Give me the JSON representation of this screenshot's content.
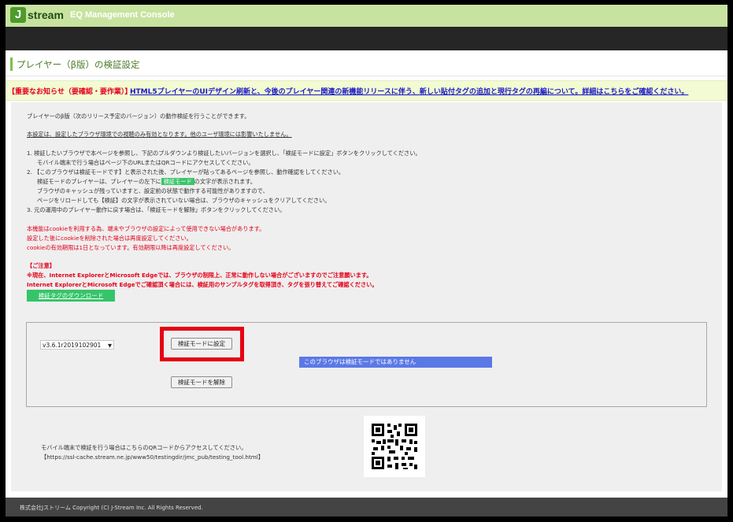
{
  "header": {
    "logo_mark": "J",
    "logo_text": "stream",
    "app_title": "EQ Management Console"
  },
  "page_title": "プレイヤー（β版）の検証設定",
  "notice": {
    "tag": "【重要なお知らせ（要確認・要作業）】",
    "link": "HTML5プレイヤーのUIデザイン刷新と、今後のプレイヤー関連の新機能リリースに伴う、新しい貼付タグの追加と現行タグの再編について。詳細はこちらをご確認ください。"
  },
  "content": {
    "intro": "プレイヤーのβ版（次のリリース予定のバージョン）の動作検証を行うことができます。",
    "scope_note": "本設定は、設定したブラウザ環境での視聴のみ有効となります。他のユーザ環境には影響いたしません。",
    "step1": "1. 検証したいブラウザで本ページを参照し、下記のプルダウンより検証したいバージョンを選択し、「検証モードに設定」ボタンをクリックしてください。",
    "step1_sub": "モバイル端末で行う場合はページ下のURLまたはQRコードにアクセスしてください。",
    "step2": "2. 【このブラウザは検証モードです】と表示された後、プレイヤーが貼ってあるページを参照し、動作確認をしてください。",
    "step2_sub1_pre": "検証モードのプレイヤーは、プレイヤーの左下に",
    "step2_sub1_badge": "検証モード",
    "step2_sub1_post": "の文字が表示されます。",
    "step2_sub2": "ブラウザのキャッシュが残っていますと、設定前の状態で動作する可能性がありますので、",
    "step2_sub3": "ページをリロードしても【検証】の文字が表示されていない場合は、ブラウザのキャッシュをクリアしてください。",
    "step3": "3. 元の運用中のプレイヤー動作に戻す場合は、「検証モードを解除」ボタンをクリックしてください。",
    "cookie1": "本機能はcookieを利用する為、端末やブラウザの設定によって使用できない場合があります。",
    "cookie2": "設定した後にcookieを削除された場合は再度設定してください。",
    "cookie3": "cookieの有効期限は1日となっています。有効期限以降は再度設定してください。",
    "caution_title": "【ご注意】",
    "caution1": "※現在、Internet ExplorerとMicrosoft Edgeでは、ブラウザの制限上、正常に動作しない場合がございますのでご注意願います。",
    "caution2": "Internet ExplorerとMicrosoft Edgeでご確認頂く場合には、検証用のサンプルタグを取得頂き、タグを張り替えてご確認ください。",
    "download_button": "検証タグのダウンロード"
  },
  "controls": {
    "version_selected": "v3.6.1r2019102901",
    "set_button": "検証モードに設定",
    "clear_button": "検証モードを解除",
    "status_text": "このブラウザは検証モードではありません"
  },
  "mobile": {
    "text": "モバイル端末で検証を行う場合はこちらのQRコードからアクセスしてください。",
    "url": "【https://ssl-cache.stream.ne.jp/www50/testingdir/jmc_pub/testing_tool.html】"
  },
  "footer": {
    "text": "株式会社Jストリーム  Copyright (C) J-Stream Inc. All Rights Reserved."
  },
  "colors": {
    "header_green": "#c7e39f",
    "accent_green": "#36c46a",
    "notice_red": "#e4001a",
    "status_blue": "#5b79e6",
    "highlight_red": "#e60012"
  }
}
